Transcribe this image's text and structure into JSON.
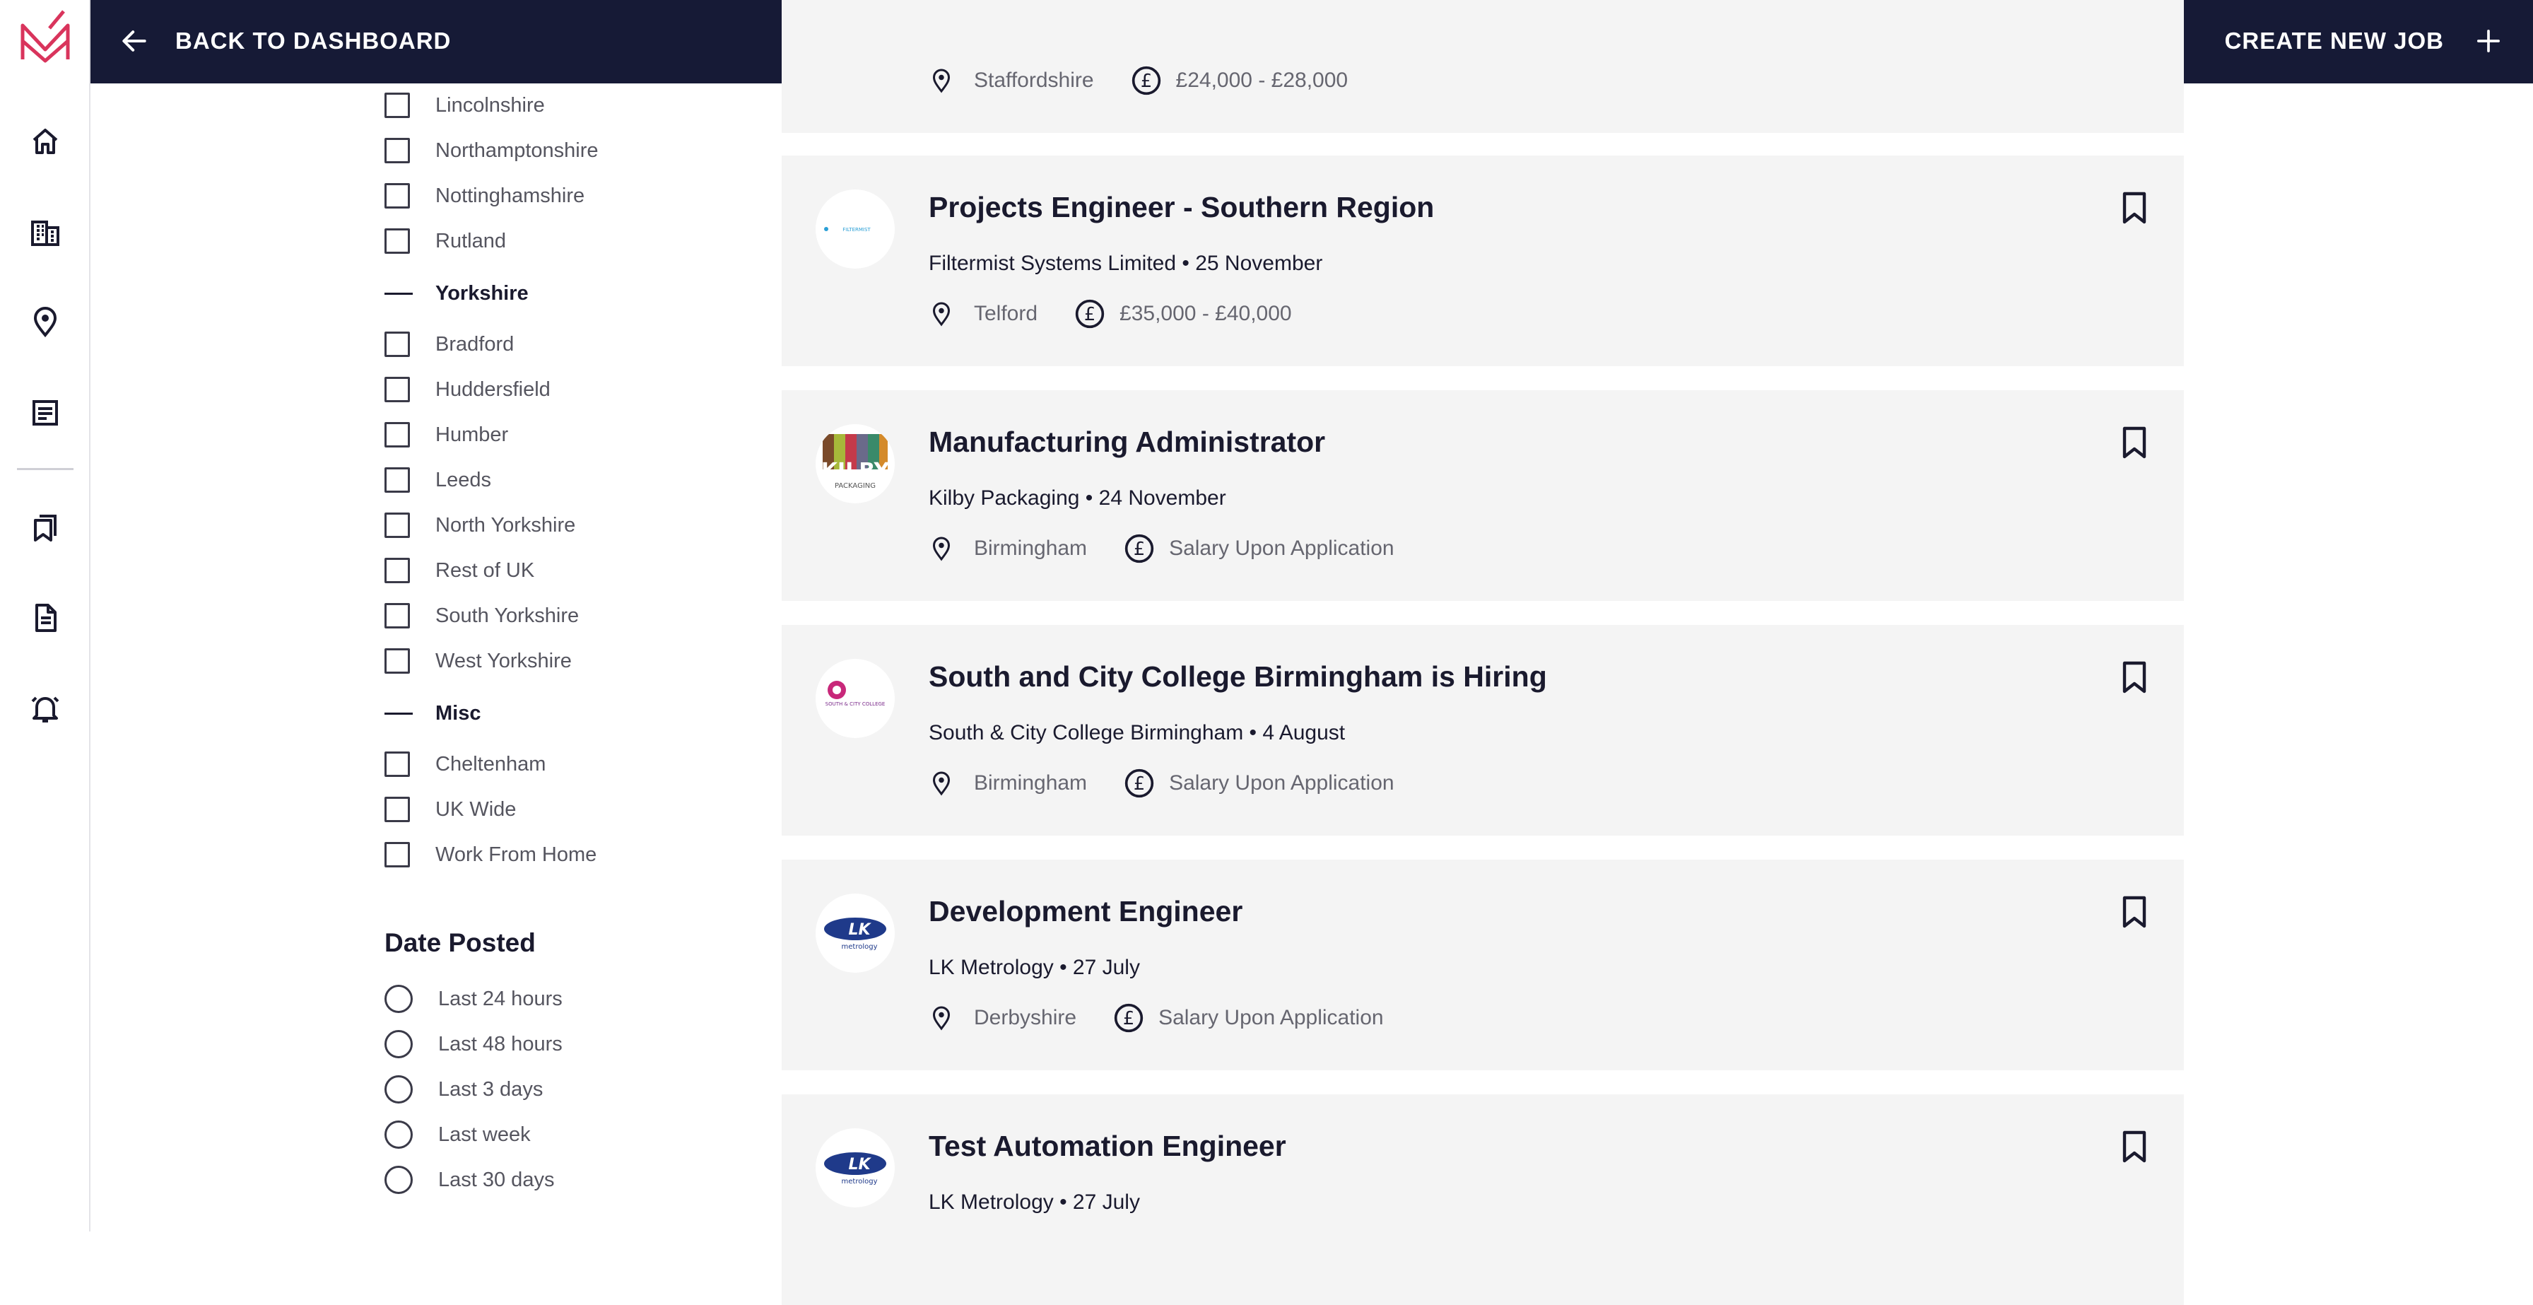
{
  "topbar": {
    "back_label": "BACK TO DASHBOARD",
    "create_label": "CREATE NEW JOB"
  },
  "colors": {
    "topbar_bg": "#161a36",
    "logo_accent": "#d9345c",
    "card_bg": "#f4f4f4"
  },
  "rail_icons": [
    "logo-icon",
    "home-icon",
    "building-icon",
    "location-pin-icon",
    "document-list-icon",
    "bookmarks-icon",
    "file-icon",
    "alarm-bell-icon"
  ],
  "filters": {
    "region_items_top": [
      "Lincolnshire",
      "Northamptonshire",
      "Nottinghamshire",
      "Rutland"
    ],
    "yorkshire": {
      "label": "Yorkshire",
      "items": [
        "Bradford",
        "Huddersfield",
        "Humber",
        "Leeds",
        "North Yorkshire",
        "Rest of UK",
        "South Yorkshire",
        "West Yorkshire"
      ]
    },
    "misc": {
      "label": "Misc",
      "items": [
        "Cheltenham",
        "UK Wide",
        "Work From Home"
      ]
    },
    "date_posted": {
      "title": "Date Posted",
      "options": [
        "Last 24 hours",
        "Last 48 hours",
        "Last 3 days",
        "Last week",
        "Last 30 days"
      ]
    }
  },
  "jobs": [
    {
      "title": "",
      "company_date": "",
      "location": "Staffordshire",
      "salary": "£24,000 - £28,000"
    },
    {
      "title": "Projects Engineer - Southern Region",
      "company_date": "Filtermist Systems Limited • 25 November",
      "location": "Telford",
      "salary": "£35,000 - £40,000",
      "logo": "FILTERMIST"
    },
    {
      "title": "Manufacturing Administrator",
      "company_date": "Kilby Packaging • 24 November",
      "location": "Birmingham",
      "salary": "Salary Upon Application",
      "logo": "KILBY",
      "logo_sub": "PACKAGING"
    },
    {
      "title": "South and City College Birmingham is Hiring",
      "company_date": "South & City College Birmingham • 4 August",
      "location": "Birmingham",
      "salary": "Salary Upon Application",
      "logo": "SOUTH & CITY COLLEGE"
    },
    {
      "title": "Development Engineer",
      "company_date": "LK Metrology • 27 July",
      "location": "Derbyshire",
      "salary": "Salary Upon Application",
      "logo": "metrology"
    },
    {
      "title": "Test Automation Engineer",
      "company_date": "LK Metrology • 27 July",
      "location": "",
      "salary": "",
      "logo": "metrology"
    }
  ]
}
